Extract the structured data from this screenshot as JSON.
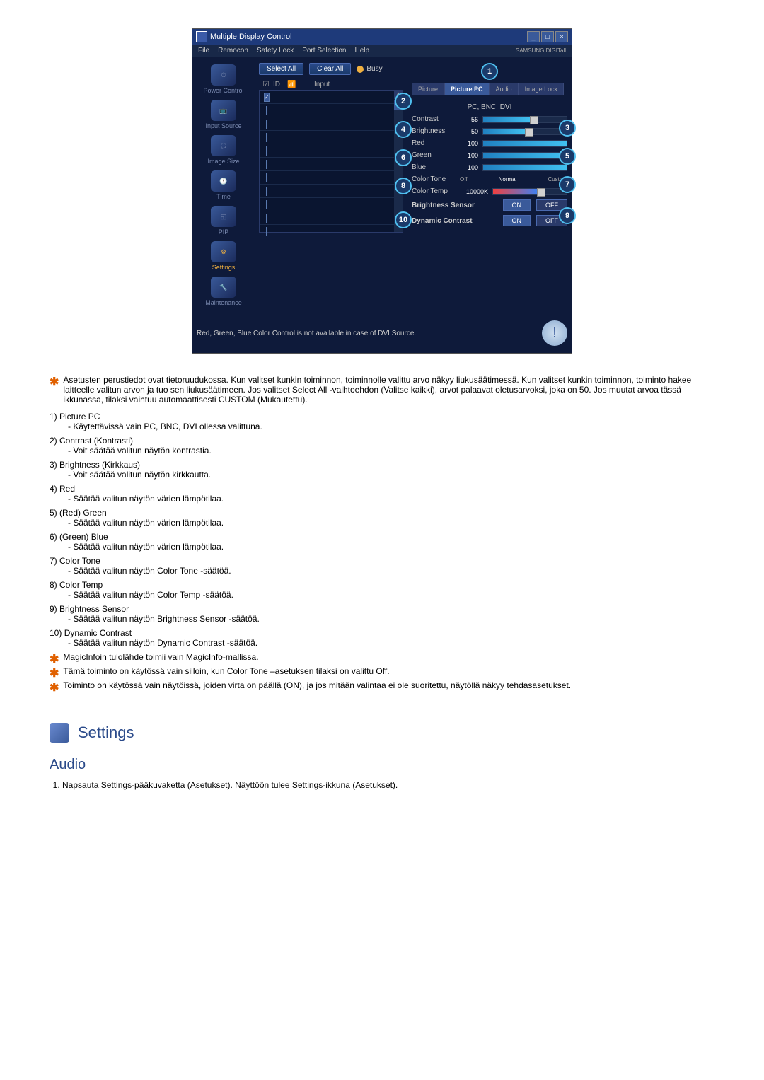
{
  "app": {
    "title": "Multiple Display Control",
    "menu": [
      "File",
      "Remocon",
      "Safety Lock",
      "Port Selection",
      "Help"
    ],
    "brand": "SAMSUNG DIGITall"
  },
  "sidebar": {
    "items": [
      {
        "label": "Power Control"
      },
      {
        "label": "Input Source"
      },
      {
        "label": "Image Size"
      },
      {
        "label": "Time"
      },
      {
        "label": "PIP"
      },
      {
        "label": "Settings",
        "active": true
      },
      {
        "label": "Maintenance"
      }
    ]
  },
  "toolbar": {
    "select_all": "Select All",
    "clear_all": "Clear All",
    "busy": "Busy"
  },
  "list": {
    "headers": {
      "id": "ID",
      "input": "Input"
    }
  },
  "tabs": {
    "picture": "Picture",
    "picture_pc": "Picture PC",
    "audio": "Audio",
    "image_lock": "Image Lock"
  },
  "panel": {
    "subheader": "PC, BNC, DVI",
    "contrast": {
      "label": "Contrast",
      "value": "56"
    },
    "brightness": {
      "label": "Brightness",
      "value": "50"
    },
    "red": {
      "label": "Red",
      "value": "100"
    },
    "green": {
      "label": "Green",
      "value": "100"
    },
    "blue": {
      "label": "Blue",
      "value": "100"
    },
    "color_tone": {
      "label": "Color Tone",
      "options": [
        "Off",
        "Normal",
        "Custom"
      ]
    },
    "color_temp": {
      "label": "Color Temp",
      "value": "10000K"
    },
    "brightness_sensor": {
      "label": "Brightness Sensor",
      "on": "ON",
      "off": "OFF"
    },
    "dynamic_contrast": {
      "label": "Dynamic Contrast",
      "on": "ON",
      "off": "OFF"
    }
  },
  "note": "Red, Green, Blue Color Control is not available in case of DVI Source.",
  "callouts": [
    "1",
    "2",
    "3",
    "4",
    "5",
    "6",
    "7",
    "8",
    "9",
    "10"
  ],
  "doc": {
    "intro": "Asetusten perustiedot ovat tietoruudukossa. Kun valitset kunkin toiminnon, toiminnolle valittu arvo näkyy liukusäätimessä. Kun valitset kunkin toiminnon, toiminto hakee laitteelle valitun arvon ja tuo sen liukusäätimeen. Jos valitset Select All -vaihtoehdon (Valitse kaikki), arvot palaavat oletusarvoksi, joka on 50. Jos muutat arvoa tässä ikkunassa, tilaksi vaihtuu automaattisesti CUSTOM (Mukautettu).",
    "items": [
      {
        "num": "1)",
        "title": "Picture PC",
        "desc": "- Käytettävissä vain PC, BNC, DVI ollessa valittuna."
      },
      {
        "num": "2)",
        "title": "Contrast (Kontrasti)",
        "desc": "- Voit säätää valitun näytön kontrastia."
      },
      {
        "num": "3)",
        "title": "Brightness (Kirkkaus)",
        "desc": "- Voit säätää valitun näytön kirkkautta."
      },
      {
        "num": "4)",
        "title": "Red",
        "desc": "- Säätää valitun näytön värien lämpötilaa."
      },
      {
        "num": "5)",
        "title": "(Red) Green",
        "desc": "- Säätää valitun näytön värien lämpötilaa."
      },
      {
        "num": "6)",
        "title": "(Green) Blue",
        "desc": "- Säätää valitun näytön värien lämpötilaa."
      },
      {
        "num": "7)",
        "title": "Color Tone",
        "desc": "- Säätää valitun näytön Color Tone -säätöä."
      },
      {
        "num": "8)",
        "title": "Color Temp",
        "desc": "- Säätää valitun näytön Color Temp -säätöä."
      },
      {
        "num": "9)",
        "title": "Brightness Sensor",
        "desc": "- Säätää valitun näytön Brightness Sensor -säätöä."
      },
      {
        "num": "10)",
        "title": "Dynamic Contrast",
        "desc": "- Säätää valitun näytön Dynamic Contrast -säätöä."
      }
    ],
    "footnotes": [
      "MagicInfoin tulolähde toimii vain MagicInfo-mallissa.",
      "Tämä toiminto on käytössä vain silloin, kun Color Tone –asetuksen tilaksi on valittu Off.",
      "Toiminto on käytössä vain näytöissä, joiden virta on päällä (ON), ja jos mitään valintaa ei ole suoritettu, näytöllä näkyy tehdasasetukset."
    ],
    "section_title": "Settings",
    "subsection": "Audio",
    "audio_step": "Napsauta Settings-pääkuvaketta (Asetukset). Näyttöön tulee Settings-ikkuna (Asetukset)."
  }
}
